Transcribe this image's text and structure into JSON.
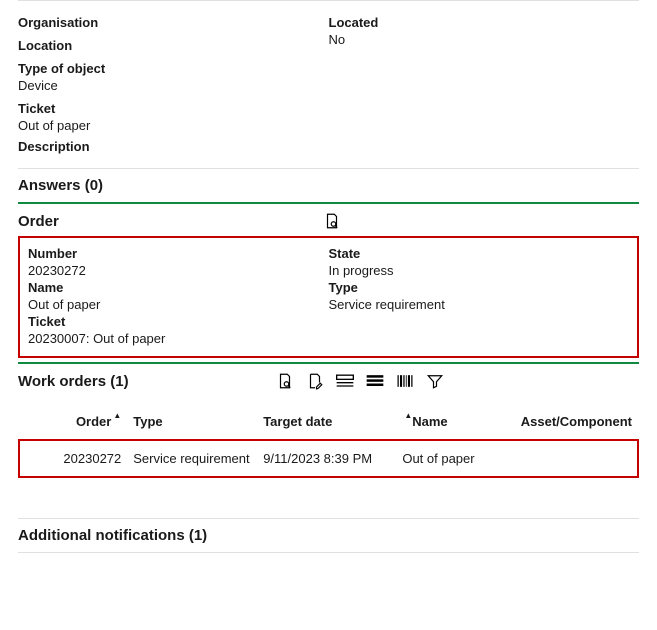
{
  "details": {
    "organisation_label": "Organisation",
    "organisation_value": "",
    "located_label": "Located",
    "located_value": "No",
    "location_label": "Location",
    "location_value": "",
    "type_of_object_label": "Type of object",
    "type_of_object_value": "Device",
    "ticket_label": "Ticket",
    "ticket_value": "Out of paper",
    "description_label": "Description"
  },
  "answers": {
    "title": "Answers (0)"
  },
  "order": {
    "heading": "Order",
    "number_label": "Number",
    "number_value": "20230272",
    "state_label": "State",
    "state_value": "In progress",
    "name_label": "Name",
    "name_value": "Out of paper",
    "type_label": "Type",
    "type_value": "Service requirement",
    "ticket_label": "Ticket",
    "ticket_value": "20230007: Out of paper"
  },
  "work_orders": {
    "title": "Work orders (1)",
    "columns": {
      "order": "Order",
      "type": "Type",
      "target_date": "Target date",
      "name": "Name",
      "asset": "Asset/Component"
    },
    "rows": [
      {
        "order": "20230272",
        "type": "Service requirement",
        "target_date": "9/11/2023 8:39 PM",
        "name": "Out of paper",
        "asset": ""
      }
    ]
  },
  "additional_notifications": {
    "title": "Additional notifications (1)"
  }
}
